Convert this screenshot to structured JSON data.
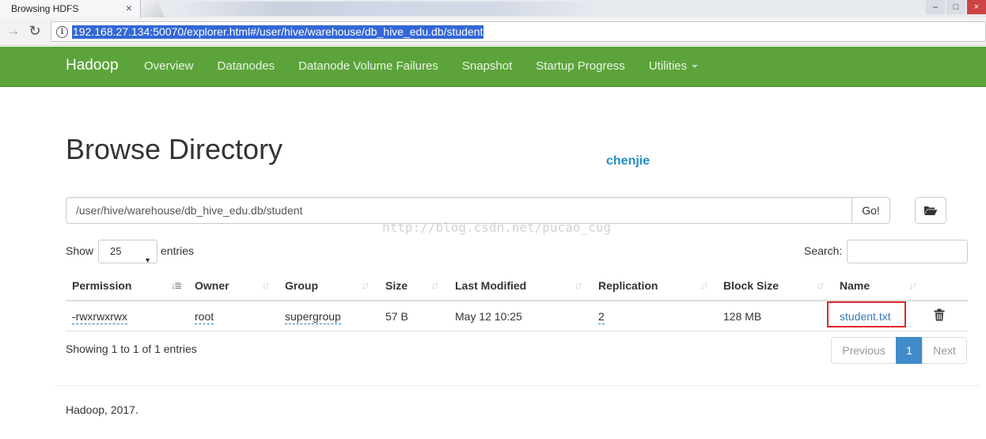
{
  "browser": {
    "tab_title": "Browsing HDFS",
    "tab_close": "×",
    "url": "192.168.27.134:50070/explorer.html#/user/hive/warehouse/db_hive_edu.db/student"
  },
  "navbar": {
    "brand": "Hadoop",
    "links": [
      "Overview",
      "Datanodes",
      "Datanode Volume Failures",
      "Snapshot",
      "Startup Progress",
      "Utilities"
    ],
    "color": "#5ca33b"
  },
  "page": {
    "title": "Browse Directory",
    "overlay_name": "chenjie",
    "watermark": "http://blog.csdn.net/pucao_cug"
  },
  "path_bar": {
    "value": "/user/hive/warehouse/db_hive_edu.db/student",
    "go_label": "Go!",
    "folder_icon": "folder-open-icon"
  },
  "table_controls": {
    "show_label": "Show",
    "page_size": "25",
    "entries_label": "entries",
    "search_label": "Search:",
    "search_value": ""
  },
  "table": {
    "columns": [
      "Permission",
      "Owner",
      "Group",
      "Size",
      "Last Modified",
      "Replication",
      "Block Size",
      "Name"
    ],
    "rows": [
      {
        "permission": "-rwxrwxrwx",
        "owner": "root",
        "group": "supergroup",
        "size": "57 B",
        "last_modified": "May 12 10:25",
        "replication": "2",
        "block_size": "128 MB",
        "name": "student.txt"
      }
    ],
    "info": "Showing 1 to 1 of 1 entries"
  },
  "pagination": {
    "previous": "Previous",
    "current": "1",
    "next": "Next",
    "active_color": "#428bca"
  },
  "footer": "Hadoop, 2017."
}
